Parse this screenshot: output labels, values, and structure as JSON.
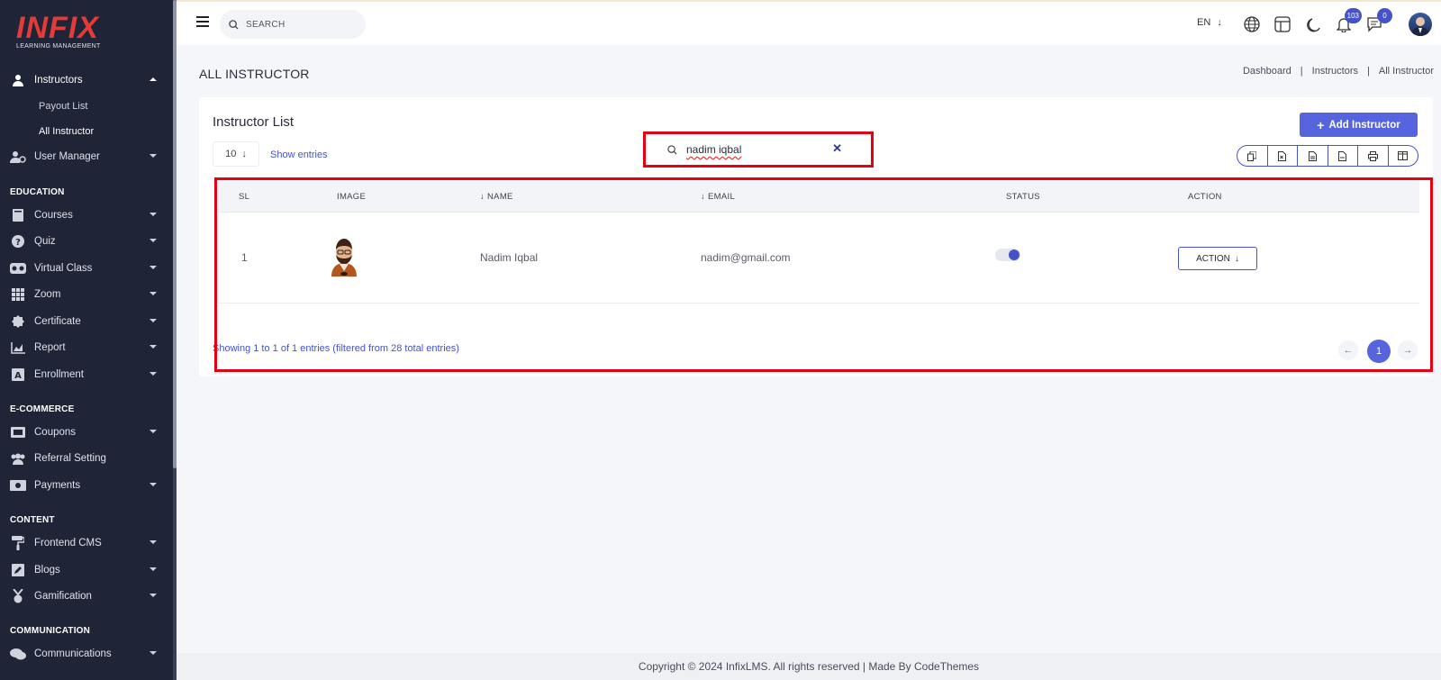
{
  "brand": {
    "logo_text": "INFIX",
    "tagline": "LEARNING MANAGEMENT",
    "accent": "#e33a3a"
  },
  "sidebar": {
    "instructors": {
      "label": "Instructors",
      "icon": "user-icon"
    },
    "instructor_sub": [
      "Payout List",
      "All Instructor"
    ],
    "user_manager": {
      "label": "User Manager",
      "icon": "user-gear-icon"
    },
    "sections": [
      "EDUCATION",
      "E-COMMERCE",
      "CONTENT",
      "COMMUNICATION"
    ],
    "education": [
      {
        "label": "Courses",
        "icon": "book-icon"
      },
      {
        "label": "Quiz",
        "icon": "question-icon"
      },
      {
        "label": "Virtual Class",
        "icon": "vr-icon"
      },
      {
        "label": "Zoom",
        "icon": "grid-icon"
      },
      {
        "label": "Certificate",
        "icon": "certificate-icon"
      },
      {
        "label": "Report",
        "icon": "chart-icon"
      },
      {
        "label": "Enrollment",
        "icon": "enroll-icon"
      }
    ],
    "ecommerce": [
      {
        "label": "Coupons",
        "icon": "ticket-icon"
      },
      {
        "label": "Referral Setting",
        "icon": "users-icon"
      },
      {
        "label": "Payments",
        "icon": "money-icon"
      }
    ],
    "content": [
      {
        "label": "Frontend CMS",
        "icon": "paint-roller-icon"
      },
      {
        "label": "Blogs",
        "icon": "edit-icon"
      },
      {
        "label": "Gamification",
        "icon": "medal-icon"
      }
    ],
    "communication": [
      {
        "label": "Communications",
        "icon": "chat-icon"
      }
    ]
  },
  "topbar": {
    "search_placeholder": "SEARCH",
    "language": "EN",
    "notification_count": "103",
    "message_count": "0"
  },
  "page": {
    "title": "ALL INSTRUCTOR",
    "breadcrumb": [
      "Dashboard",
      "Instructors",
      "All Instructor"
    ]
  },
  "card": {
    "title": "Instructor List",
    "add_button": "Add Instructor",
    "entries_value": "10",
    "show_entries": "Show entries",
    "search_value": "nadim iqbal"
  },
  "table": {
    "headers": [
      "SL",
      "IMAGE",
      "NAME",
      "EMAIL",
      "STATUS",
      "ACTION"
    ],
    "rows": [
      {
        "sl": "1",
        "name": "Nadim Iqbal",
        "email": "nadim@gmail.com",
        "status_on": true,
        "action": "ACTION"
      }
    ],
    "info": "Showing 1 to 1 of 1 entries (filtered from 28 total entries)",
    "current_page": "1"
  },
  "footer": "Copyright © 2024 InfixLMS. All rights reserved | Made By CodeThemes",
  "colors": {
    "primary": "#5664dd",
    "sidebar_bg": "#1f2537",
    "highlight": "#e60012"
  }
}
